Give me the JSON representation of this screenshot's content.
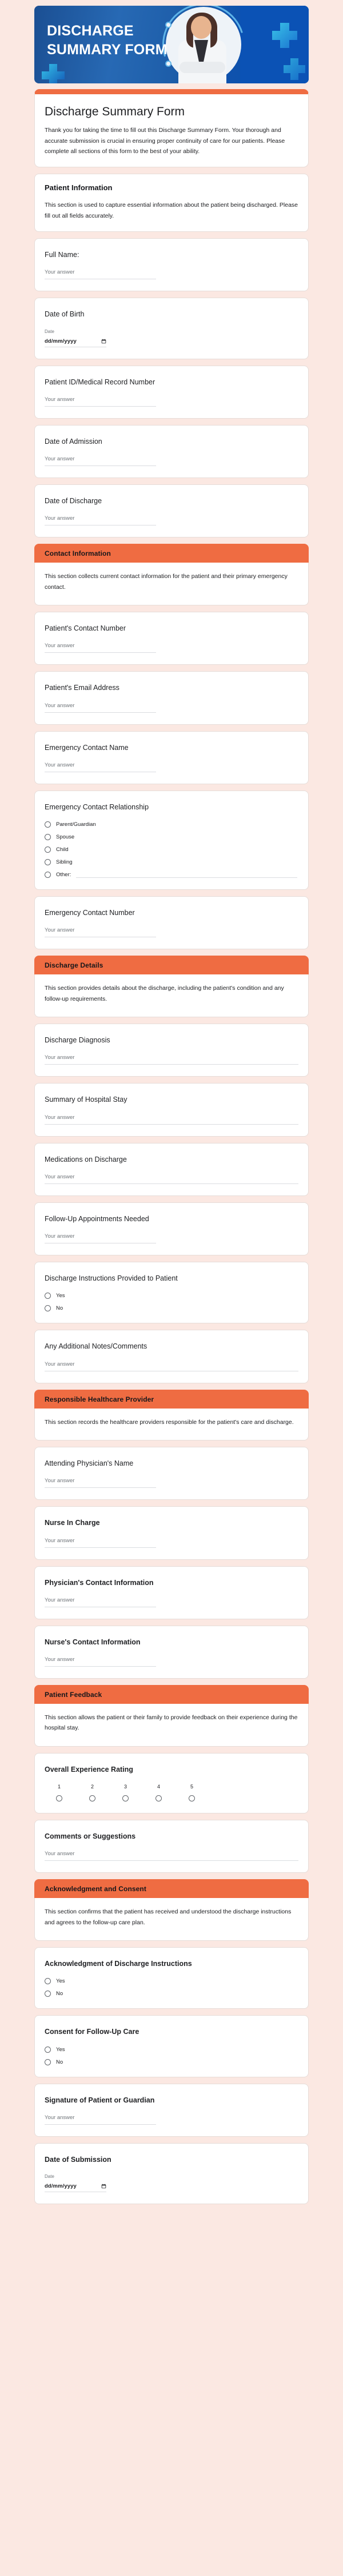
{
  "banner": {
    "title_line1": "DISCHARGE",
    "title_line2": "SUMMARY FORM",
    "bg_color": "#1b4f93",
    "accent_color": "#0b52b5"
  },
  "theme": {
    "page_background": "#fbe8e2",
    "accent": "#ef6c42",
    "card_background": "#ffffff"
  },
  "header": {
    "title": "Discharge Summary Form",
    "description": "Thank you for taking the time to fill out this Discharge Summary Form. Your thorough and accurate submission is crucial in ensuring proper continuity of care for our patients. Please complete all sections of this form to the best of your ability."
  },
  "placeholders": {
    "your_answer": "Your answer",
    "date_label": "Date",
    "date_value": "dd/mm/yyyy"
  },
  "sections": [
    {
      "id": "patient-information",
      "title": "Patient Information",
      "banner": false,
      "description": "This section is used to capture essential information about the patient being discharged. Please fill out all fields accurately.",
      "questions": [
        {
          "id": "full-name",
          "title": "Full Name:",
          "type": "short_text",
          "bold": false
        },
        {
          "id": "date-of-birth",
          "title": "Date of Birth",
          "type": "date",
          "bold": false
        },
        {
          "id": "patient-id",
          "title": "Patient ID/Medical Record Number",
          "type": "short_text",
          "bold": false
        },
        {
          "id": "date-of-admission",
          "title": "Date of Admission",
          "type": "short_text",
          "bold": false
        },
        {
          "id": "date-of-discharge",
          "title": "Date of Discharge",
          "type": "short_text",
          "bold": false
        }
      ]
    },
    {
      "id": "contact-information",
      "title": "Contact Information",
      "banner": true,
      "description": "This section collects current contact information for the patient and their primary emergency contact.",
      "questions": [
        {
          "id": "patients-contact-number",
          "title": "Patient's Contact Number",
          "type": "short_text",
          "bold": false
        },
        {
          "id": "patients-email-address",
          "title": "Patient's Email Address",
          "type": "short_text",
          "bold": false
        },
        {
          "id": "emergency-contact-name",
          "title": "Emergency Contact Name",
          "type": "short_text",
          "bold": false
        },
        {
          "id": "emergency-contact-relationship",
          "title": "Emergency Contact Relationship",
          "type": "radio",
          "bold": false,
          "options": [
            "Parent/Guardian",
            "Spouse",
            "Child",
            "Sibling"
          ],
          "other_label": "Other:"
        },
        {
          "id": "emergency-contact-number",
          "title": "Emergency Contact Number",
          "type": "short_text",
          "bold": false
        }
      ]
    },
    {
      "id": "discharge-details",
      "title": "Discharge Details",
      "banner": true,
      "description": "This section provides details about the discharge, including the patient's condition and any follow-up requirements.",
      "questions": [
        {
          "id": "discharge-diagnosis",
          "title": "Discharge Diagnosis",
          "type": "long_text",
          "bold": false
        },
        {
          "id": "summary-of-hospital-stay",
          "title": "Summary of Hospital Stay",
          "type": "long_text",
          "bold": false
        },
        {
          "id": "medications-on-discharge",
          "title": "Medications on Discharge",
          "type": "long_text",
          "bold": false
        },
        {
          "id": "follow-up-appointments-needed",
          "title": "Follow-Up Appointments Needed",
          "type": "short_text",
          "bold": false
        },
        {
          "id": "discharge-instructions-provided",
          "title": "Discharge Instructions Provided to Patient",
          "type": "radio",
          "bold": false,
          "options": [
            "Yes",
            "No"
          ]
        },
        {
          "id": "additional-notes",
          "title": "Any Additional Notes/Comments",
          "type": "long_text",
          "bold": false
        }
      ]
    },
    {
      "id": "responsible-healthcare-provider",
      "title": "Responsible Healthcare Provider",
      "banner": true,
      "description": "This section records the healthcare providers responsible for the patient's care and discharge.",
      "questions": [
        {
          "id": "attending-physicians-name",
          "title": "Attending Physician's Name",
          "type": "short_text",
          "bold": false
        },
        {
          "id": "nurse-in-charge",
          "title": "Nurse In Charge",
          "type": "short_text",
          "bold": true
        },
        {
          "id": "physicians-contact-information",
          "title": "Physician's Contact Information",
          "type": "short_text",
          "bold": true
        },
        {
          "id": "nurses-contact-information",
          "title": "Nurse's Contact Information",
          "type": "short_text",
          "bold": true
        }
      ]
    },
    {
      "id": "patient-feedback",
      "title": "Patient Feedback",
      "banner": true,
      "description": "This section allows the patient or their family to provide feedback on their experience during the hospital stay.",
      "questions": [
        {
          "id": "overall-experience-rating",
          "title": "Overall Experience Rating",
          "type": "scale",
          "bold": true,
          "scale": [
            "1",
            "2",
            "3",
            "4",
            "5"
          ]
        },
        {
          "id": "comments-or-suggestions",
          "title": "Comments or Suggestions",
          "type": "long_text",
          "bold": true
        }
      ]
    },
    {
      "id": "acknowledgment-and-consent",
      "title": "Acknowledgment and Consent",
      "banner": true,
      "description": "This section confirms that the patient has received and understood the discharge instructions and agrees to the follow-up care plan.",
      "questions": [
        {
          "id": "acknowledgment-of-discharge-instructions",
          "title": "Acknowledgment of Discharge Instructions",
          "type": "radio",
          "bold": true,
          "options": [
            "Yes",
            "No"
          ]
        },
        {
          "id": "consent-for-follow-up-care",
          "title": "Consent for Follow-Up Care",
          "type": "radio",
          "bold": true,
          "options": [
            "Yes",
            "No"
          ]
        },
        {
          "id": "signature-of-patient-or-guardian",
          "title": "Signature of Patient or Guardian",
          "type": "short_text",
          "bold": true
        },
        {
          "id": "date-of-submission",
          "title": "Date of Submission",
          "type": "date",
          "bold": true
        }
      ]
    }
  ]
}
